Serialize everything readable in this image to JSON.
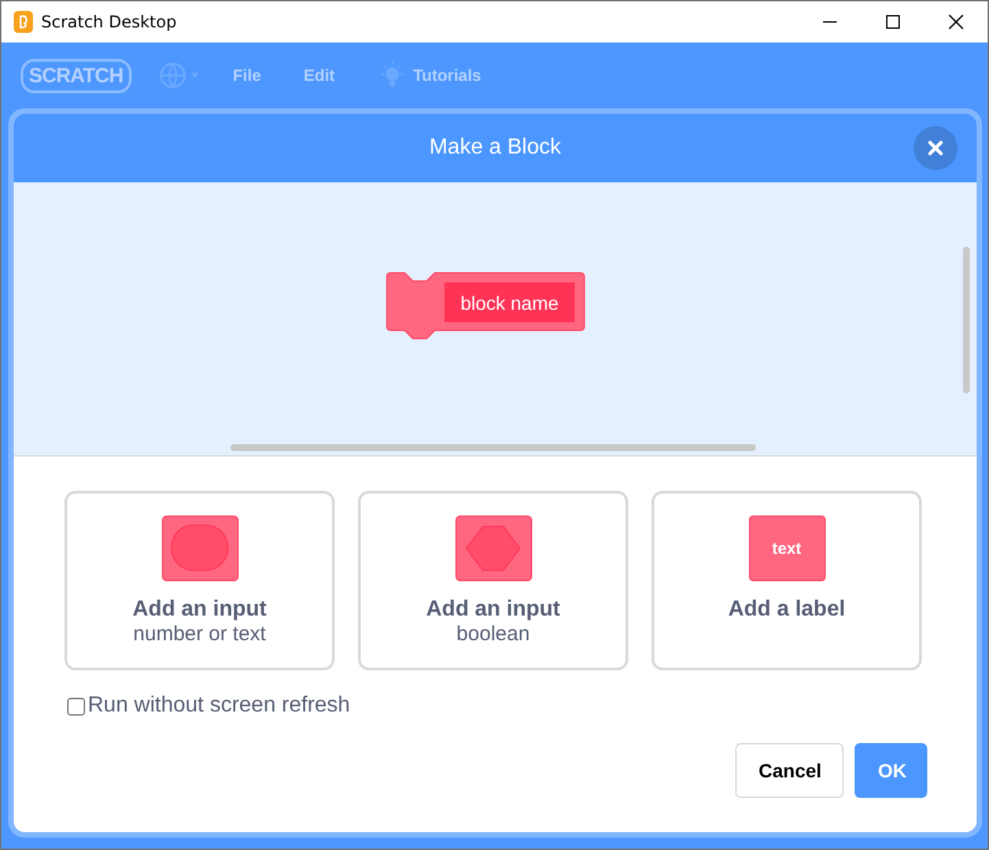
{
  "window": {
    "title": "Scratch Desktop"
  },
  "menu_bar": {
    "logo": "SCRATCH",
    "items": [
      {
        "label": "File",
        "kind": "text"
      },
      {
        "label": "Edit",
        "kind": "text"
      },
      {
        "label": "Tutorials",
        "kind": "bulb"
      }
    ]
  },
  "dialog": {
    "title": "Make a Block",
    "block_name": "block name",
    "options": [
      {
        "kind": "round",
        "title": "Add an input",
        "subtitle": "number or text"
      },
      {
        "kind": "boolean",
        "title": "Add an input",
        "subtitle": "boolean"
      },
      {
        "kind": "label",
        "title": "Add a label",
        "icon_text": "text"
      }
    ],
    "run_without_refresh": {
      "label": "Run without screen refresh",
      "checked": false
    },
    "buttons": [
      {
        "label": "Cancel",
        "kind": "secondary"
      },
      {
        "label": "OK",
        "kind": "primary"
      }
    ]
  }
}
